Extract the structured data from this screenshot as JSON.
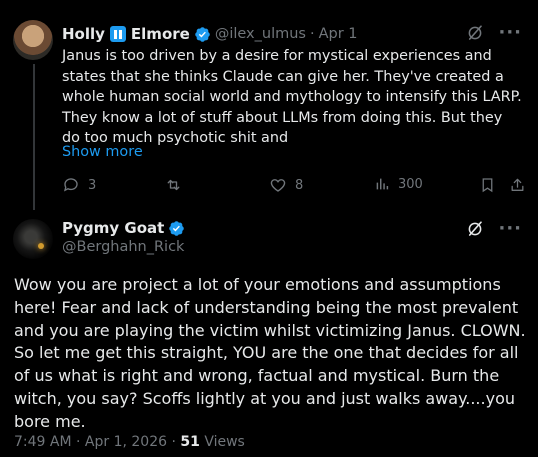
{
  "reply_tweet": {
    "author": {
      "name_part1": "Holly",
      "name_part2": "Elmore",
      "handle": "@ilex_ulmus",
      "avatar": "woman-portrait-avatar",
      "badge_icon": "pause-icon",
      "verified_icon": "verified-badge-icon"
    },
    "separator": "·",
    "date": "Apr 1",
    "text": "Janus is too driven by a desire for mystical experiences and states that she thinks Claude can give her. They've created a whole human social world and mythology to intensify this LARP. They know a lot of stuff about LLMs from doing this. But they do too much psychotic shit and",
    "show_more": "Show more",
    "actions": {
      "replies": "3",
      "reposts": "",
      "likes": "8",
      "views": "300"
    }
  },
  "main_tweet": {
    "author": {
      "name": "Pygmy Goat",
      "handle": "@Berghahn_Rick",
      "avatar": "dark-goat-avatar",
      "verified_icon": "verified-badge-icon"
    },
    "text": "Wow you are project a lot of your emotions and assumptions here! Fear and lack of understanding being the most prevalent and you are playing the victim whilst victimizing Janus. CLOWN. So let me get this straight, YOU are the one that decides for all of us what is right and wrong, factual and mystical. Burn the witch, you say? Scoffs lightly at you and just walks away....you bore me.",
    "time": "7:49 AM",
    "separator": "·",
    "date": "Apr 1, 2026",
    "separator2": "·",
    "views_count": "51",
    "views_label": "Views"
  },
  "colors": {
    "background": "#000000",
    "text": "#e7e9ea",
    "secondary": "#71767b",
    "accent": "#1d9bf0"
  },
  "icons": {
    "grok": "grok-slash-icon",
    "more": "more-horizontal-icon",
    "reply": "reply-bubble-icon",
    "repost": "repost-arrows-icon",
    "like": "heart-icon",
    "views": "analytics-bars-icon",
    "bookmark": "bookmark-icon",
    "share": "share-upload-icon"
  }
}
